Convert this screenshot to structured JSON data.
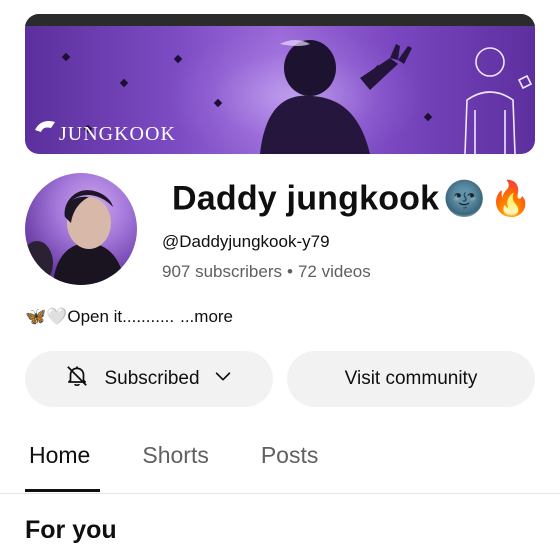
{
  "banner": {
    "logo_text": "JUNGKOOK",
    "colors": {
      "primary": "#7d4cc4",
      "dark": "#2b2b2b"
    }
  },
  "channel": {
    "name": "Daddy jungkook",
    "emojis": [
      "🌚",
      "🔥"
    ],
    "handle": "@Daddyjungkook-y79",
    "subscribers": "907 subscribers",
    "separator": "•",
    "videos": "72 videos",
    "description_emojis": [
      "🦋",
      "🤍"
    ],
    "description": "Open it...........",
    "more_label": "...more"
  },
  "actions": {
    "subscribed_label": "Subscribed",
    "visit_community_label": "Visit community"
  },
  "tabs": [
    {
      "label": "Home",
      "active": true
    },
    {
      "label": "Shorts",
      "active": false
    },
    {
      "label": "Posts",
      "active": false
    }
  ],
  "section": {
    "title": "For you"
  },
  "icons": {
    "bell": "bell-off-icon",
    "chevron": "chevron-down-icon"
  }
}
